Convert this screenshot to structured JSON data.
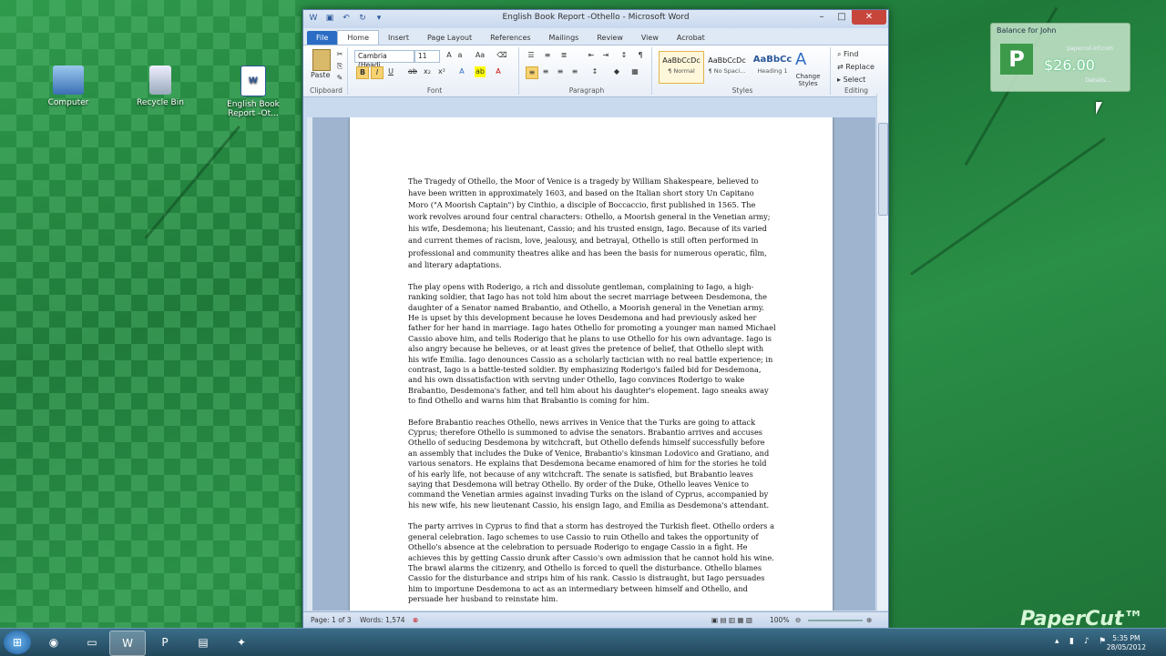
{
  "desktop": {
    "icons": [
      {
        "label": "Computer"
      },
      {
        "label": "Recycle Bin"
      },
      {
        "label": "English Book Report -Ot..."
      }
    ]
  },
  "window": {
    "title": "English Book Report -Othello - Microsoft Word",
    "tabs": [
      "File",
      "Home",
      "Insert",
      "Page Layout",
      "References",
      "Mailings",
      "Review",
      "View",
      "Acrobat"
    ],
    "ribbon": {
      "clipboard": {
        "paste": "Paste",
        "label": "Clipboard"
      },
      "font": {
        "name": "Cambria (Headi",
        "size": "11",
        "label": "Font",
        "bold": "B",
        "italic": "I",
        "underline": "U"
      },
      "paragraph": {
        "label": "Paragraph"
      },
      "styles": {
        "items": [
          {
            "preview": "AaBbCcDc",
            "name": "¶ Normal"
          },
          {
            "preview": "AaBbCcDc",
            "name": "¶ No Spaci..."
          },
          {
            "preview": "AaBbCc",
            "name": "Heading 1"
          }
        ],
        "change": "Change Styles",
        "label": "Styles"
      },
      "editing": {
        "find": "Find",
        "replace": "Replace",
        "select": "Select",
        "label": "Editing"
      }
    },
    "document": {
      "paragraphs": [
        "The Tragedy of Othello, the Moor of Venice is a tragedy by William Shakespeare, believed to have been written in approximately 1603, and based on the Italian short story Un Capitano Moro (\"A Moorish Captain\") by Cinthio, a disciple of Boccaccio, first published in 1565. The work revolves around four central characters: Othello, a Moorish general in the Venetian army; his wife, Desdemona; his lieutenant, Cassio; and his trusted ensign, Iago. Because of its varied and current themes of racism, love, jealousy, and betrayal, Othello is still often performed in professional and community theatres alike and has been the basis for numerous operatic, film, and literary adaptations.",
        "The play opens with Roderigo, a rich and dissolute gentleman, complaining to Iago, a high-ranking soldier, that Iago has not told him about the secret marriage between Desdemona, the daughter of a Senator named Brabantio, and Othello, a Moorish general in the Venetian army. He is upset by this development because he loves Desdemona and had previously asked her father for her hand in marriage. Iago hates Othello for promoting a younger man named Michael Cassio above him, and tells Roderigo that he plans to use Othello for his own advantage. Iago is also angry because he believes, or at least gives the pretence of belief, that Othello slept with his wife Emilia. Iago denounces Cassio as a scholarly tactician with no real battle experience; in contrast, Iago is a battle-tested soldier. By emphasizing Roderigo's failed bid for Desdemona, and his own dissatisfaction with serving under Othello, Iago convinces Roderigo to wake Brabantio, Desdemona's father, and tell him about his daughter's elopement. Iago sneaks away to find Othello and warns him that Brabantio is coming for him.",
        "Before Brabantio reaches Othello, news arrives in Venice that the Turks are going to attack Cyprus; therefore Othello is summoned to advise the senators. Brabantio arrives and accuses Othello of seducing Desdemona by witchcraft, but Othello defends himself successfully before an assembly that includes the Duke of Venice, Brabantio's kinsman Lodovico and Gratiano, and various senators. He explains that Desdemona became enamored of him for the stories he told of his early life, not because of any witchcraft. The senate is satisfied, but Brabantio leaves saying that Desdemona will betray Othello. By order of the Duke, Othello leaves Venice to command the Venetian armies against invading Turks on the island of Cyprus, accompanied by his new wife, his new lieutenant Cassio, his ensign Iago, and Emilia as Desdemona's attendant.",
        "The party arrives in Cyprus to find that a storm has destroyed the Turkish fleet. Othello orders a general celebration. Iago schemes to use Cassio to ruin Othello and takes the opportunity of Othello's absence at the celebration to persuade Roderigo to engage Cassio in a fight. He achieves this by getting Cassio drunk after Cassio's own admission that he cannot hold his wine. The brawl alarms the citizenry, and Othello is forced to quell the disturbance. Othello blames Cassio for the disturbance and strips him of his rank. Cassio is distraught, but Iago persuades him to importune Desdemona to act as an intermediary between himself and Othello, and persuade her husband to reinstate him."
      ]
    },
    "status": {
      "page": "Page: 1 of 3",
      "words": "Words: 1,574",
      "zoom": "100%"
    }
  },
  "papercut": {
    "title": "Balance for John",
    "amount": "$26.00",
    "url": "papercut-inf.com",
    "details": "Details...",
    "brand": "PaperCut™"
  },
  "taskbar": {
    "time": "5:35 PM",
    "date": "28/05/2012"
  },
  "colors": {
    "accent": "#2b6cc4",
    "desktop": "#2a8f47"
  }
}
